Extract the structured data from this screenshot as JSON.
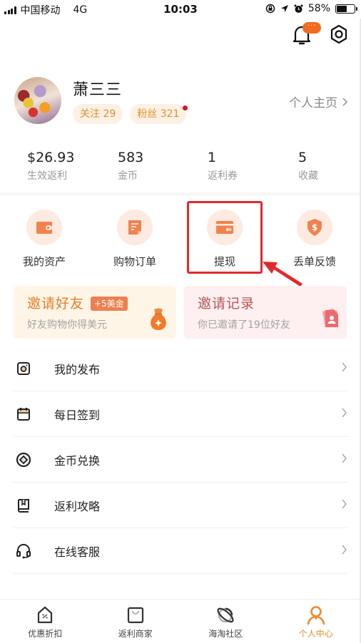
{
  "status_bar": {
    "carrier": "中国移动",
    "network": "4G",
    "time": "10:03",
    "battery_percent_text": "58%",
    "battery_level": 0.58
  },
  "header": {
    "notification_badge": "···",
    "icons": [
      "bell-icon",
      "settings-icon"
    ]
  },
  "profile": {
    "name": "萧三三",
    "following_label": "关注 29",
    "followers_label": "粉丝 321",
    "followers_has_new": true,
    "homepage_link": "个人主页"
  },
  "stats": [
    {
      "value": "$26.93",
      "label": "生效返利"
    },
    {
      "value": "583",
      "label": "金币"
    },
    {
      "value": "1",
      "label": "返利券"
    },
    {
      "value": "5",
      "label": "收藏"
    }
  ],
  "quick_actions": [
    {
      "label": "我的资产",
      "icon": "wallet-icon"
    },
    {
      "label": "购物订单",
      "icon": "order-list-icon"
    },
    {
      "label": "提现",
      "icon": "card-icon",
      "highlighted": true
    },
    {
      "label": "丢单反馈",
      "icon": "shield-dollar-icon"
    }
  ],
  "invite_cards": {
    "invite_friends": {
      "title": "邀请好友",
      "badge": "+5美金",
      "subtitle": "好友购物你得美元",
      "icon": "money-bag-icon"
    },
    "invite_records": {
      "title": "邀请记录",
      "subtitle": "你已邀请了19位好友",
      "icon": "contact-doc-icon"
    }
  },
  "menu": [
    {
      "label": "我的发布",
      "icon": "camera-icon"
    },
    {
      "label": "每日签到",
      "icon": "calendar-icon"
    },
    {
      "label": "金币兑换",
      "icon": "coin-icon"
    },
    {
      "label": "返利攻略",
      "icon": "book-icon"
    },
    {
      "label": "在线客服",
      "icon": "headset-icon"
    }
  ],
  "tab_bar": [
    {
      "label": "优惠折扣",
      "icon": "discount-tag-icon",
      "active": false
    },
    {
      "label": "返利商家",
      "icon": "shopping-bag-icon",
      "active": false
    },
    {
      "label": "海淘社区",
      "icon": "planet-icon",
      "active": false
    },
    {
      "label": "个人中心",
      "icon": "user-icon",
      "active": true
    }
  ],
  "colors": {
    "accent": "#f08a2a",
    "highlight_box": "#e4282a",
    "badge": "#f26a1d"
  }
}
